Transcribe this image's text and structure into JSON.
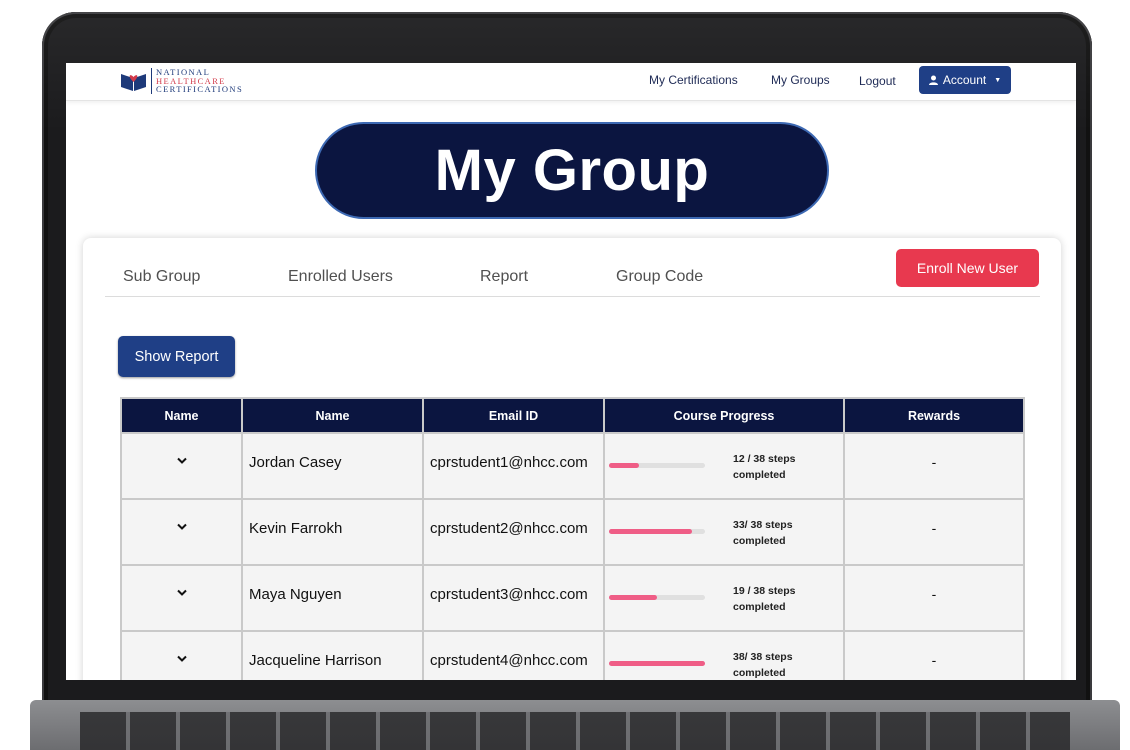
{
  "brand": {
    "logo_line1": "NATIONAL",
    "logo_line2": "HEALTHCARE",
    "logo_line3": "CERTIFICATIONS"
  },
  "nav": {
    "my_certifications": "My Certifications",
    "my_groups": "My Groups",
    "logout": "Logout",
    "account": "Account"
  },
  "page_title": "My Group",
  "tabs": [
    "Sub Group",
    "Enrolled Users",
    "Report",
    "Group Code"
  ],
  "actions": {
    "enroll": "Enroll New User",
    "show_report": "Show Report"
  },
  "table": {
    "headers": [
      "Name",
      "Name",
      "Email ID",
      "Course Progress",
      "Rewards"
    ],
    "total_steps": 38,
    "rows": [
      {
        "name": "Jordan Casey",
        "email": "cprstudent1@nhcc.com",
        "progress_label": "12 / 38 steps",
        "completed": 12,
        "status": "completed",
        "rewards": "-"
      },
      {
        "name": "Kevin Farrokh",
        "email": "cprstudent2@nhcc.com",
        "progress_label": "33/ 38 steps",
        "completed": 33,
        "status": "completed",
        "rewards": "-"
      },
      {
        "name": "Maya Nguyen",
        "email": "cprstudent3@nhcc.com",
        "progress_label": "19 / 38 steps",
        "completed": 19,
        "status": "completed",
        "rewards": "-"
      },
      {
        "name": "Jacqueline Harrison",
        "email": "cprstudent4@nhcc.com",
        "progress_label": "38/ 38 steps",
        "completed": 38,
        "status": "completed",
        "rewards": "-"
      }
    ]
  },
  "colors": {
    "navy": "#0b1540",
    "blue_button": "#1f3f86",
    "red_button": "#e8394f",
    "progress_fill": "#ef5d86"
  }
}
